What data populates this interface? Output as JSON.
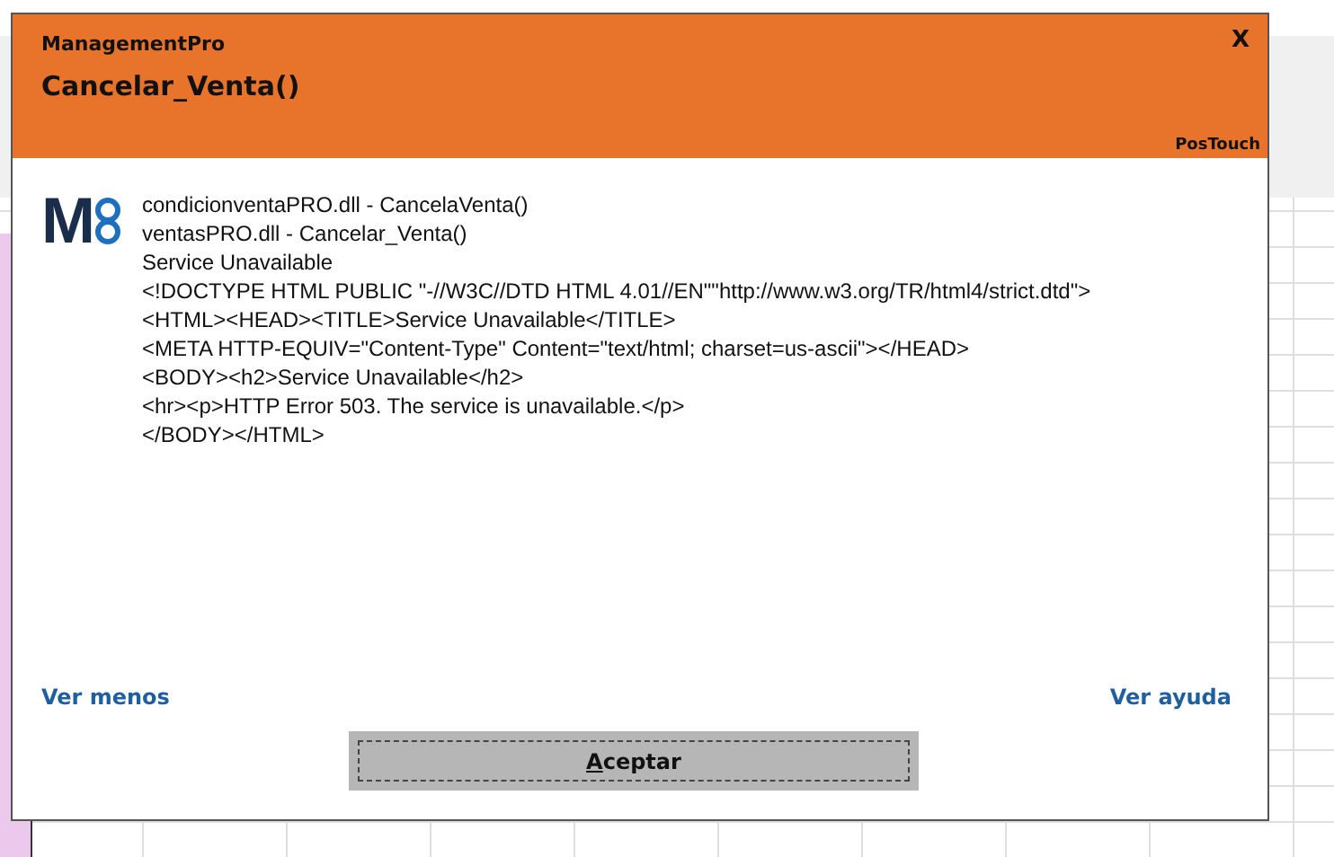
{
  "dialog": {
    "app_name": "ManagementPro",
    "title": "Cancelar_Venta()",
    "close": "X",
    "brand": "PosTouch",
    "logo": {
      "letter": "M"
    },
    "message_lines": [
      "condicionventaPRO.dll - CancelaVenta()",
      "ventasPRO.dll - Cancelar_Venta()",
      "Service Unavailable",
      "<!DOCTYPE HTML PUBLIC \"-//W3C//DTD HTML 4.01//EN\"\"http://www.w3.org/TR/html4/strict.dtd\">",
      "<HTML><HEAD><TITLE>Service Unavailable</TITLE>",
      "<META HTTP-EQUIV=\"Content-Type\" Content=\"text/html; charset=us-ascii\"></HEAD>",
      "<BODY><h2>Service Unavailable</h2>",
      "<hr><p>HTTP Error 503. The service is unavailable.</p>",
      "</BODY></HTML>"
    ],
    "links": [
      "Ver menos",
      "Ver ayuda"
    ],
    "button": {
      "label": "Aceptar",
      "focused": true
    }
  }
}
